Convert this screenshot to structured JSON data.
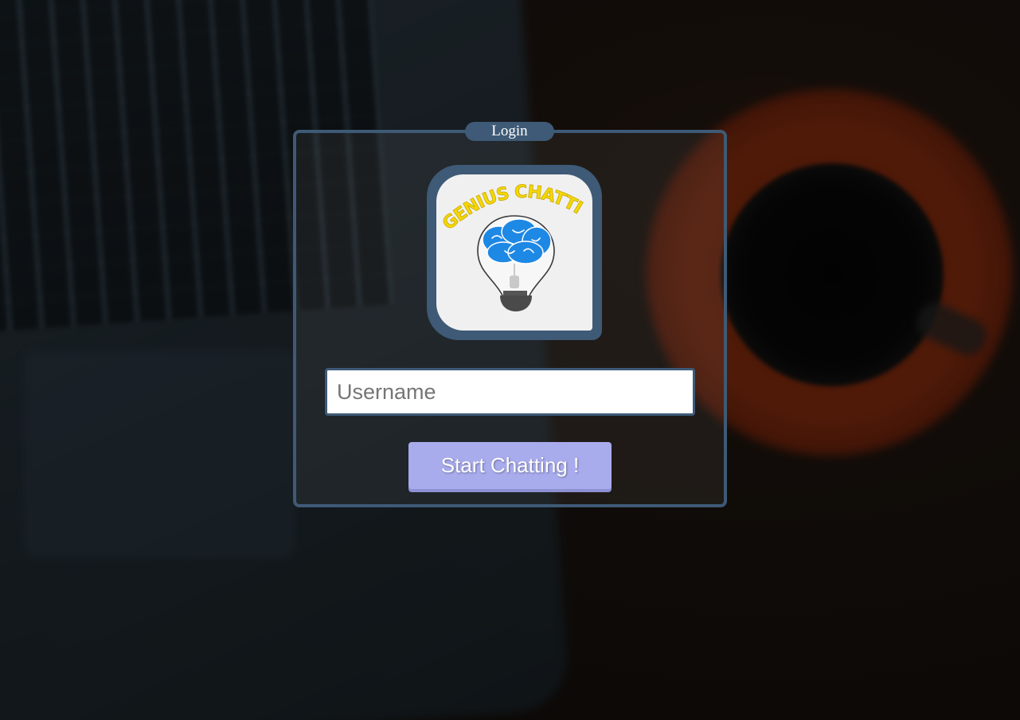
{
  "login": {
    "legend": "Login",
    "logo": {
      "icon": "genius-chatting-lightbulb-brain-logo",
      "text": "GENIUS CHATTING",
      "text_color": "#f5d800",
      "brain_color": "#1e88e5",
      "frame_color": "#3e5a76"
    },
    "username": {
      "value": "",
      "placeholder": "Username"
    },
    "start_button": {
      "label": "Start Chatting !",
      "color": "#a8abec"
    }
  },
  "theme": {
    "panel_border": "#3e5a76",
    "background": "#15110e"
  }
}
